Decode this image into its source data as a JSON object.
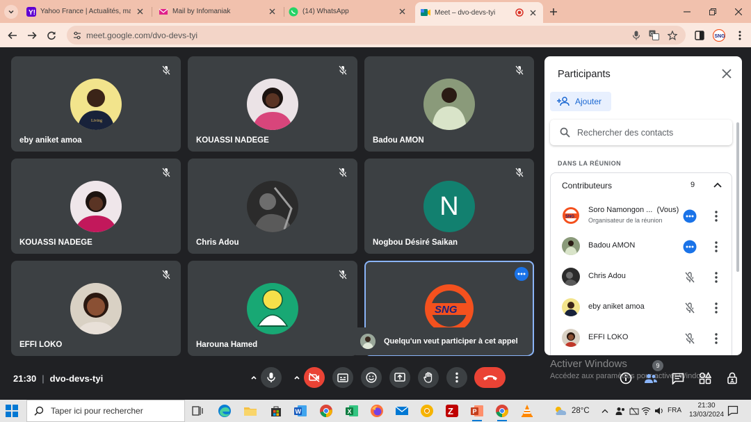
{
  "browser": {
    "tabs": [
      {
        "title": "Yahoo France | Actualités, mail et",
        "icon": "yahoo-icon",
        "color": "#6001d2"
      },
      {
        "title": "Mail by Infomaniak",
        "icon": "infomaniak-mail-icon",
        "color": "#e0218a"
      },
      {
        "title": "(14) WhatsApp",
        "icon": "whatsapp-icon",
        "color": "#25d366"
      },
      {
        "title": "Meet – dvo-devs-tyi",
        "icon": "meet-icon",
        "color": "#00897b",
        "active": true,
        "recording": true
      }
    ],
    "url": "meet.google.com/dvo-devs-tyi"
  },
  "meeting": {
    "time": "21:30",
    "code": "dvo-devs-tyi",
    "tiles": [
      {
        "name": "eby aniket amoa",
        "muted": true,
        "avatar_color": "#f2e48c"
      },
      {
        "name": "KOUASSI NADEGE",
        "muted": true,
        "avatar_color": "#e9cfcf"
      },
      {
        "name": "Badou AMON",
        "muted": true,
        "avatar_color": "#7a8b6e"
      },
      {
        "name": "KOUASSI NADEGE",
        "muted": true,
        "avatar_color": "#e0b8c8"
      },
      {
        "name": "Chris Adou",
        "muted": true,
        "avatar_color": "#3a3a3a"
      },
      {
        "name": "Nogbou Désiré Saikan",
        "muted": true,
        "initial": "N",
        "avatar_color": "#12806f"
      },
      {
        "name": "EFFI LOKO",
        "muted": true,
        "avatar_color": "#c98a6a"
      },
      {
        "name": "Harouna Hamed",
        "muted": true,
        "avatar_color": "#18a874"
      },
      {
        "name": "",
        "muted": false,
        "avatar_color": "#f4511e",
        "speaking": true
      }
    ],
    "toast": "Quelqu'un veut participer à cet appel"
  },
  "participants": {
    "title": "Participants",
    "add_label": "Ajouter",
    "search_placeholder": "Rechercher des contacts",
    "section": "DANS LA RÉUNION",
    "group_label": "Contributeurs",
    "group_count": "9",
    "list": [
      {
        "name": "Soro Namongon ...",
        "you": "(Vous)",
        "sub": "Organisateur de la réunion",
        "action": "more-blue"
      },
      {
        "name": "Badou AMON",
        "action": "more-blue"
      },
      {
        "name": "Chris Adou",
        "action": "muted"
      },
      {
        "name": "eby aniket amoa",
        "action": "muted"
      },
      {
        "name": "EFFI LOKO",
        "action": "muted"
      }
    ]
  },
  "overlay": {
    "activate_title": "Activer Windows",
    "activate_sub": "Accédez aux paramètres pour activer Windows.",
    "people_badge": "9"
  },
  "taskbar": {
    "search_placeholder": "Taper ici pour rechercher",
    "weather": "28°C",
    "lang": "FRA",
    "time": "21:30",
    "date": "13/03/2024"
  }
}
